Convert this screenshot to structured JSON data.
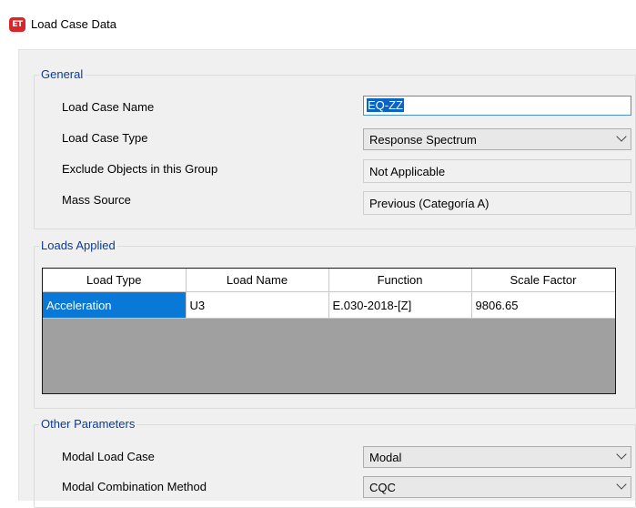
{
  "window": {
    "title": "Load Case Data",
    "icon": "ET"
  },
  "general": {
    "title": "General",
    "load_case_name_label": "Load Case Name",
    "load_case_name_value": "EQ-ZZ",
    "load_case_type_label": "Load Case Type",
    "load_case_type_value": "Response Spectrum",
    "exclude_objects_label": "Exclude Objects in this Group",
    "exclude_objects_value": "Not Applicable",
    "mass_source_label": "Mass Source",
    "mass_source_value": "Previous  (Categoría A)"
  },
  "loads_applied": {
    "title": "Loads Applied",
    "columns": [
      "Load Type",
      "Load Name",
      "Function",
      "Scale Factor"
    ],
    "rows": [
      [
        "Acceleration",
        "U3",
        "E.030-2018-[Z]",
        "9806.65"
      ]
    ]
  },
  "other_parameters": {
    "title": "Other Parameters",
    "modal_load_case_label": "Modal Load Case",
    "modal_load_case_value": "Modal",
    "modal_combination_label": "Modal Combination Method",
    "modal_combination_value": "CQC"
  },
  "colors": {
    "group_title": "#0a3c96",
    "selection": "#0a78d7",
    "app_icon": "#d9262a"
  }
}
